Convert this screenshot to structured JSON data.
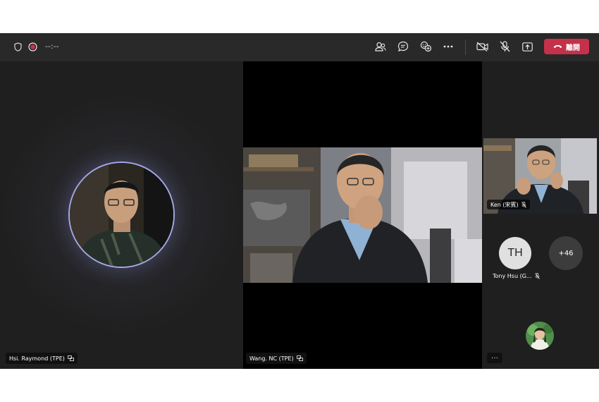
{
  "toolbar": {
    "timer": "--:--",
    "leave_label": "離開",
    "icons": {
      "privacy": "shield-icon",
      "recording": "record-icon",
      "participants": "people-icon",
      "chat": "chat-icon",
      "reactions": "reactions-icon",
      "more": "more-icon",
      "camera_off": "camera-off-icon",
      "mic_muted": "mic-muted-icon",
      "share": "share-icon",
      "hangup": "hangup-icon"
    },
    "colors": {
      "leave": "#c4314b",
      "recording": "#c4314b"
    }
  },
  "participants": {
    "left": {
      "name": "Hsi. Raymond (TPE)"
    },
    "center": {
      "name": "Wang. NC (TPE)"
    },
    "right_top": {
      "name": "Ken (宋賓)"
    },
    "tony": {
      "initials": "TH",
      "name": "Tony Hsu (G..."
    },
    "overflow_count": "+46"
  },
  "overflow_menu": "···"
}
